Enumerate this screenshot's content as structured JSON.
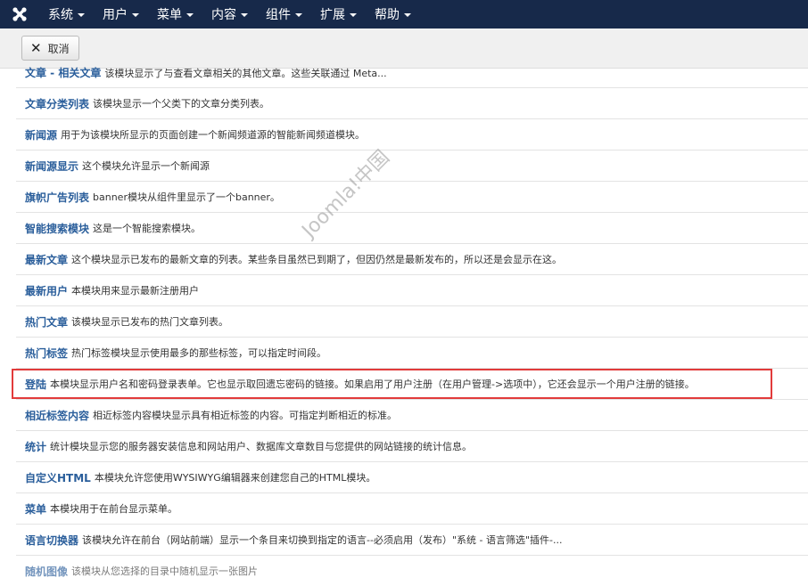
{
  "navbar": {
    "logo_icon": "joomla-logo-icon",
    "menu": [
      "系统",
      "用户",
      "菜单",
      "内容",
      "组件",
      "扩展",
      "帮助"
    ]
  },
  "toolbar": {
    "cancel_label": "取消",
    "cancel_icon": "close-icon"
  },
  "modules": [
    {
      "name": "文章 - 相关文章",
      "desc": "该模块显示了与查看文章相关的其他文章。这些关联通过 Meta..."
    },
    {
      "name": "文章分类列表",
      "desc": "该模块显示一个父类下的文章分类列表。"
    },
    {
      "name": "新闻源",
      "desc": "用于为该模块所显示的页面创建一个新闻频道源的智能新闻频道模块。"
    },
    {
      "name": "新闻源显示",
      "desc": "这个模块允许显示一个新闻源"
    },
    {
      "name": "旗帜广告列表",
      "desc": "banner模块从组件里显示了一个banner。"
    },
    {
      "name": "智能搜索模块",
      "desc": "这是一个智能搜索模块。"
    },
    {
      "name": "最新文章",
      "desc": "这个模块显示已发布的最新文章的列表。某些条目虽然已到期了，但因仍然是最新发布的，所以还是会显示在这。"
    },
    {
      "name": "最新用户",
      "desc": "本模块用来显示最新注册用户"
    },
    {
      "name": "热门文章",
      "desc": "该模块显示已发布的热门文章列表。"
    },
    {
      "name": "热门标签",
      "desc": "热门标签模块显示使用最多的那些标签，可以指定时间段。"
    },
    {
      "name": "登陆",
      "desc": "本模块显示用户名和密码登录表单。它也显示取回遗忘密码的链接。如果启用了用户注册（在用户管理->选项中），它还会显示一个用户注册的链接。"
    },
    {
      "name": "相近标签内容",
      "desc": "相近标签内容模块显示具有相近标签的内容。可指定判断相近的标准。"
    },
    {
      "name": "统计",
      "desc": "统计模块显示您的服务器安装信息和网站用户、数据库文章数目与您提供的网站链接的统计信息。"
    },
    {
      "name": "自定义HTML",
      "desc": "本模块允许您使用WYSIWYG编辑器来创建您自己的HTML模块。"
    },
    {
      "name": "菜单",
      "desc": "本模块用于在前台显示菜单。"
    },
    {
      "name": "语言切换器",
      "desc": "该模块允许在前台（网站前端）显示一个条目来切换到指定的语言--必须启用（发布）\"系统 - 语言筛选\"插件-..."
    },
    {
      "name": "随机图像",
      "desc": "该模块从您选择的目录中随机显示一张图片"
    }
  ],
  "watermark": "Joomla!中国",
  "colors": {
    "navbar": "#17294a",
    "link": "#2a5e9b",
    "highlight": "#e23b3b"
  }
}
